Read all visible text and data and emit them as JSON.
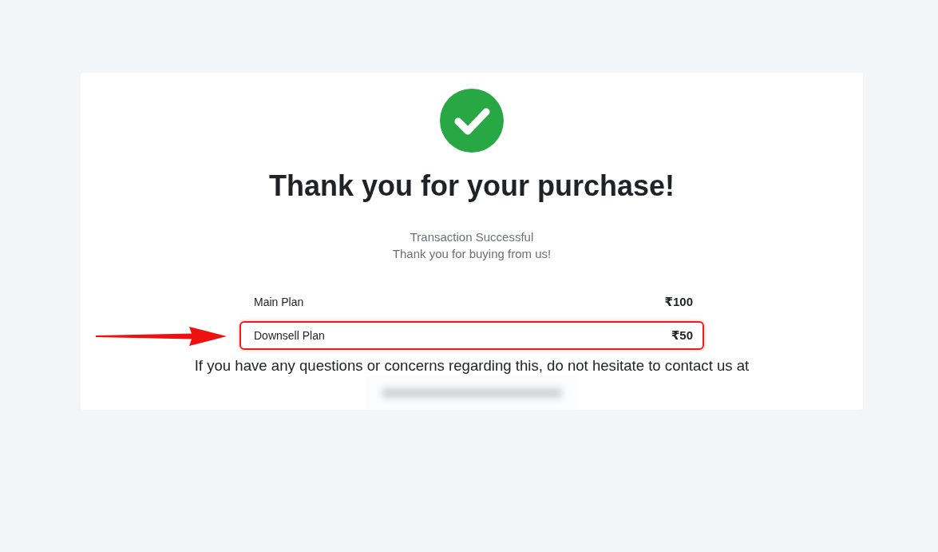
{
  "heading": "Thank you for your purchase!",
  "subtitle_lines": [
    "Transaction Successful",
    "Thank you for buying from us!"
  ],
  "plans": [
    {
      "name": "Main Plan",
      "price": "₹100",
      "highlighted": false
    },
    {
      "name": "Downsell Plan",
      "price": "₹50",
      "highlighted": true
    }
  ],
  "contact_text": "If you have any questions or concerns regarding this, do not hesitate to contact us at"
}
